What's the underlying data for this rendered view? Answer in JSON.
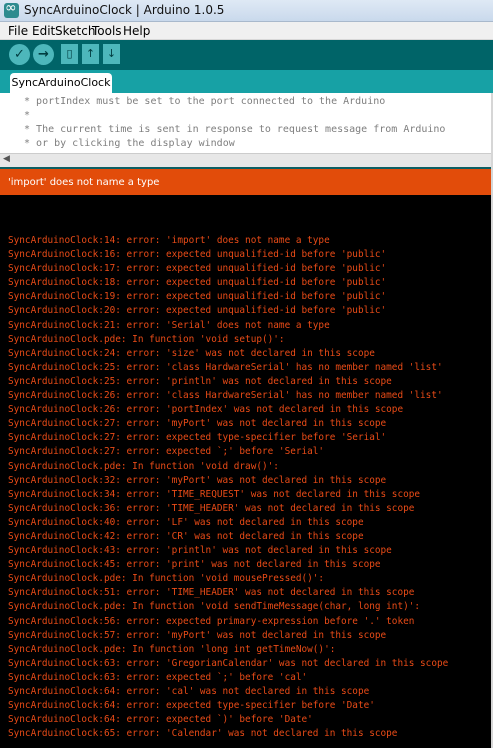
{
  "window": {
    "title": "SyncArduinoClock | Arduino 1.0.5"
  },
  "menu": [
    "File",
    "Edit",
    "Sketch",
    "Tools",
    "Help"
  ],
  "toolbar": {
    "verify_icon": "checkmark-icon",
    "upload_icon": "right-arrow-icon",
    "new_icon": "new-file-icon",
    "open_icon": "open-arrow-icon",
    "save_icon": "save-arrow-icon"
  },
  "tab": {
    "label": "SyncArduinoClock"
  },
  "editor": {
    "lines": [
      " * portIndex must be set to the port connected to the Arduino",
      " *",
      " * The current time is sent in response to request message from Arduino",
      " * or by clicking the display window"
    ]
  },
  "status": {
    "message": "'import' does not name a type"
  },
  "colors": {
    "toolbar": "#006468",
    "tabstrip": "#17a1a5",
    "error_bar": "#e24c0a",
    "console_text": "#e94b17"
  },
  "console": {
    "lines": [
      "SyncArduinoClock:14: error: 'import' does not name a type",
      "SyncArduinoClock:16: error: expected unqualified-id before 'public'",
      "SyncArduinoClock:17: error: expected unqualified-id before 'public'",
      "SyncArduinoClock:18: error: expected unqualified-id before 'public'",
      "SyncArduinoClock:19: error: expected unqualified-id before 'public'",
      "SyncArduinoClock:20: error: expected unqualified-id before 'public'",
      "SyncArduinoClock:21: error: 'Serial' does not name a type",
      "SyncArduinoClock.pde: In function 'void setup()':",
      "SyncArduinoClock:24: error: 'size' was not declared in this scope",
      "SyncArduinoClock:25: error: 'class HardwareSerial' has no member named 'list'",
      "SyncArduinoClock:25: error: 'println' was not declared in this scope",
      "SyncArduinoClock:26: error: 'class HardwareSerial' has no member named 'list'",
      "SyncArduinoClock:26: error: 'portIndex' was not declared in this scope",
      "SyncArduinoClock:27: error: 'myPort' was not declared in this scope",
      "SyncArduinoClock:27: error: expected type-specifier before 'Serial'",
      "SyncArduinoClock:27: error: expected `;' before 'Serial'",
      "SyncArduinoClock.pde: In function 'void draw()':",
      "SyncArduinoClock:32: error: 'myPort' was not declared in this scope",
      "SyncArduinoClock:34: error: 'TIME_REQUEST' was not declared in this scope",
      "SyncArduinoClock:36: error: 'TIME_HEADER' was not declared in this scope",
      "SyncArduinoClock:40: error: 'LF' was not declared in this scope",
      "SyncArduinoClock:42: error: 'CR' was not declared in this scope",
      "SyncArduinoClock:43: error: 'println' was not declared in this scope",
      "SyncArduinoClock:45: error: 'print' was not declared in this scope",
      "SyncArduinoClock.pde: In function 'void mousePressed()':",
      "SyncArduinoClock:51: error: 'TIME_HEADER' was not declared in this scope",
      "SyncArduinoClock.pde: In function 'void sendTimeMessage(char, long int)':",
      "SyncArduinoClock:56: error: expected primary-expression before '.' token",
      "SyncArduinoClock:57: error: 'myPort' was not declared in this scope",
      "SyncArduinoClock.pde: In function 'long int getTimeNow()':",
      "SyncArduinoClock:63: error: 'GregorianCalendar' was not declared in this scope",
      "SyncArduinoClock:63: error: expected `;' before 'cal'",
      "SyncArduinoClock:64: error: 'cal' was not declared in this scope",
      "SyncArduinoClock:64: error: expected type-specifier before 'Date'",
      "SyncArduinoClock:64: error: expected `)' before 'Date'",
      "SyncArduinoClock:65: error: 'Calendar' was not declared in this scope"
    ]
  }
}
